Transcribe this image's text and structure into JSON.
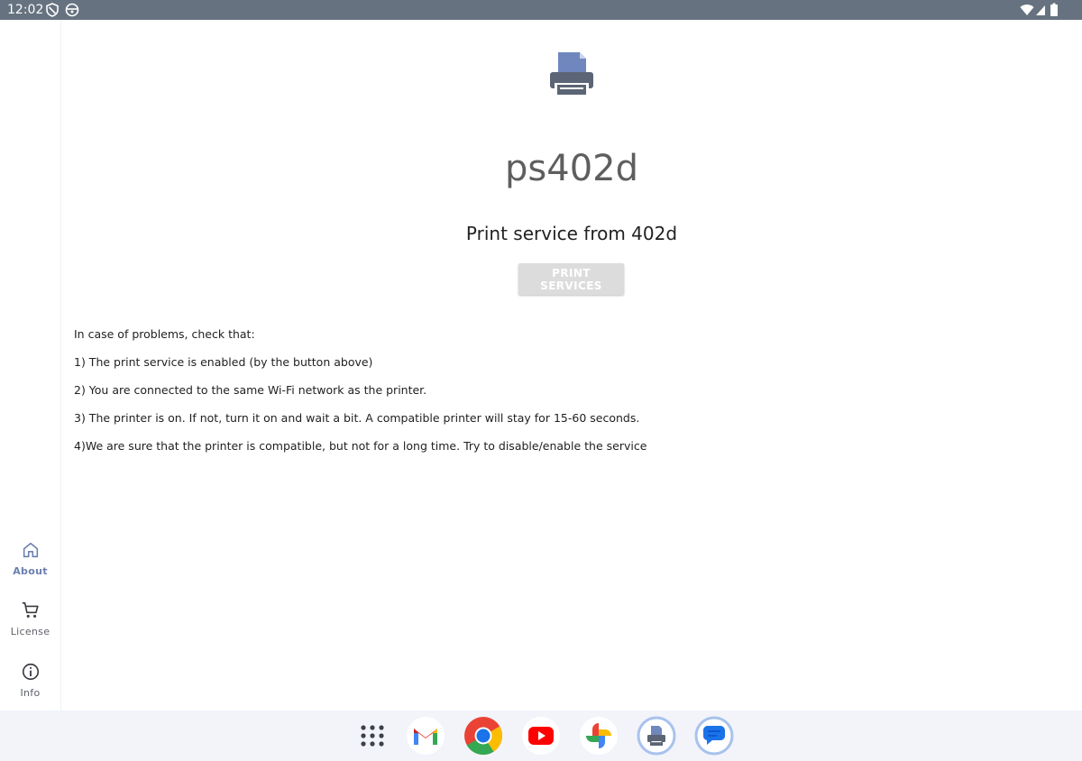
{
  "status_bar": {
    "time": "12:02",
    "left_icons": [
      "shield-icon",
      "face-icon"
    ],
    "right_icons": [
      "wifi-icon",
      "signal-icon",
      "battery-icon"
    ]
  },
  "nav_rail": {
    "items": [
      {
        "label": "About",
        "icon": "home-icon",
        "active": true
      },
      {
        "label": "License",
        "icon": "cart-icon",
        "active": false
      },
      {
        "label": "Info",
        "icon": "info-icon",
        "active": false
      }
    ]
  },
  "main": {
    "app_icon": "printer-icon",
    "title": "ps402d",
    "subtitle": "Print service from 402d",
    "button_label": "PRINT SERVICES",
    "tips": [
      "In case of problems, check that:",
      "1) The print service is enabled (by the button above)",
      "2) You are connected to the same Wi-Fi network as the printer.",
      "3) The printer is on. If not, turn it on and wait a bit. A compatible printer will stay for 15-60 seconds.",
      "4)We are sure that the printer is compatible, but not for a long time. Try to disable/enable the service"
    ]
  },
  "taskbar": {
    "apps": [
      "app-drawer-icon",
      "gmail-icon",
      "chrome-icon",
      "youtube-icon",
      "photos-icon",
      "print-app-icon",
      "messages-icon"
    ]
  },
  "colors": {
    "status_bar": "#66727f",
    "accent": "#6b7fb0",
    "button_disabled": "#dcdcdc",
    "taskbar": "#f2f4fa"
  }
}
